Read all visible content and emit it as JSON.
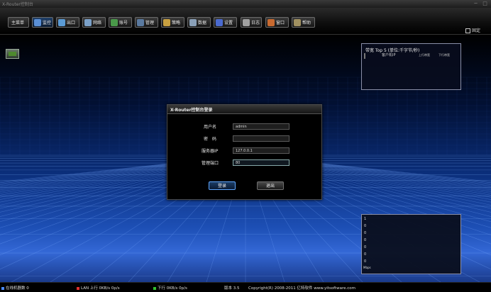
{
  "window": {
    "title": "X-Router控制台",
    "min": "─",
    "max": "□"
  },
  "toolbar": {
    "buttons": [
      {
        "name": "main-menu",
        "label": "主菜单",
        "icon": "none",
        "active": false,
        "color": "#000000"
      },
      {
        "name": "monitor",
        "label": "监控",
        "icon": "gauge-icon",
        "active": true,
        "color": "#5a8fd6"
      },
      {
        "name": "exit",
        "label": "出口",
        "icon": "exit-icon",
        "active": false,
        "color": "#5b9bd5"
      },
      {
        "name": "network",
        "label": "网络",
        "icon": "network-icon",
        "active": false,
        "color": "#7aa0c8"
      },
      {
        "name": "account",
        "label": "账号",
        "icon": "users-icon",
        "active": false,
        "color": "#4a9a4a"
      },
      {
        "name": "manage",
        "label": "管理",
        "icon": "monitor-icon",
        "active": false,
        "color": "#5a7aa0"
      },
      {
        "name": "policy",
        "label": "策略",
        "icon": "box-icon",
        "active": false,
        "color": "#c8a040"
      },
      {
        "name": "data",
        "label": "数据",
        "icon": "data-icon",
        "active": false,
        "color": "#8aa0b8"
      },
      {
        "name": "settings",
        "label": "设置",
        "icon": "settings-icon",
        "active": false,
        "color": "#4a6ad0"
      },
      {
        "name": "log",
        "label": "日志",
        "icon": "log-icon",
        "active": false,
        "color": "#a0a0a0"
      },
      {
        "name": "window",
        "label": "窗口",
        "icon": "window-icon",
        "active": false,
        "color": "#c86a30"
      },
      {
        "name": "help",
        "label": "帮助",
        "icon": "help-icon",
        "active": false,
        "color": "#a09060"
      }
    ],
    "pin_label": "固定"
  },
  "bandwidth_panel": {
    "title": "带宽 Top 5 (单位:千字节/秒)",
    "col_ip": "客户机IP",
    "col_up": "上行带宽",
    "col_down": "下行带宽"
  },
  "chart_panel": {
    "y_ticks": [
      "1",
      "0",
      "0",
      "0",
      "0",
      "0",
      "0"
    ],
    "unit": "Mbps"
  },
  "login": {
    "title": "X-Router控制台登录",
    "username_label": "用户名",
    "username_value": "admin",
    "password_label": "密　码",
    "password_value": "",
    "server_ip_label": "服务器IP",
    "server_ip_value": "127.0.0.1",
    "port_label": "管理端口",
    "port_value": "80",
    "login_button": "登录",
    "exit_button": "退出"
  },
  "status": {
    "online_count": "在线机器数 0",
    "lan_up": "LAN 上行 0KB/s 0p/s",
    "lan_down": "下行 0KB/s 0p/s",
    "version": "版本 3.5",
    "copyright": "Copyright(R) 2008-2011 亿特软件 www.yitsoftware.com",
    "accent_red": "#e03030",
    "accent_green": "#30c030"
  }
}
